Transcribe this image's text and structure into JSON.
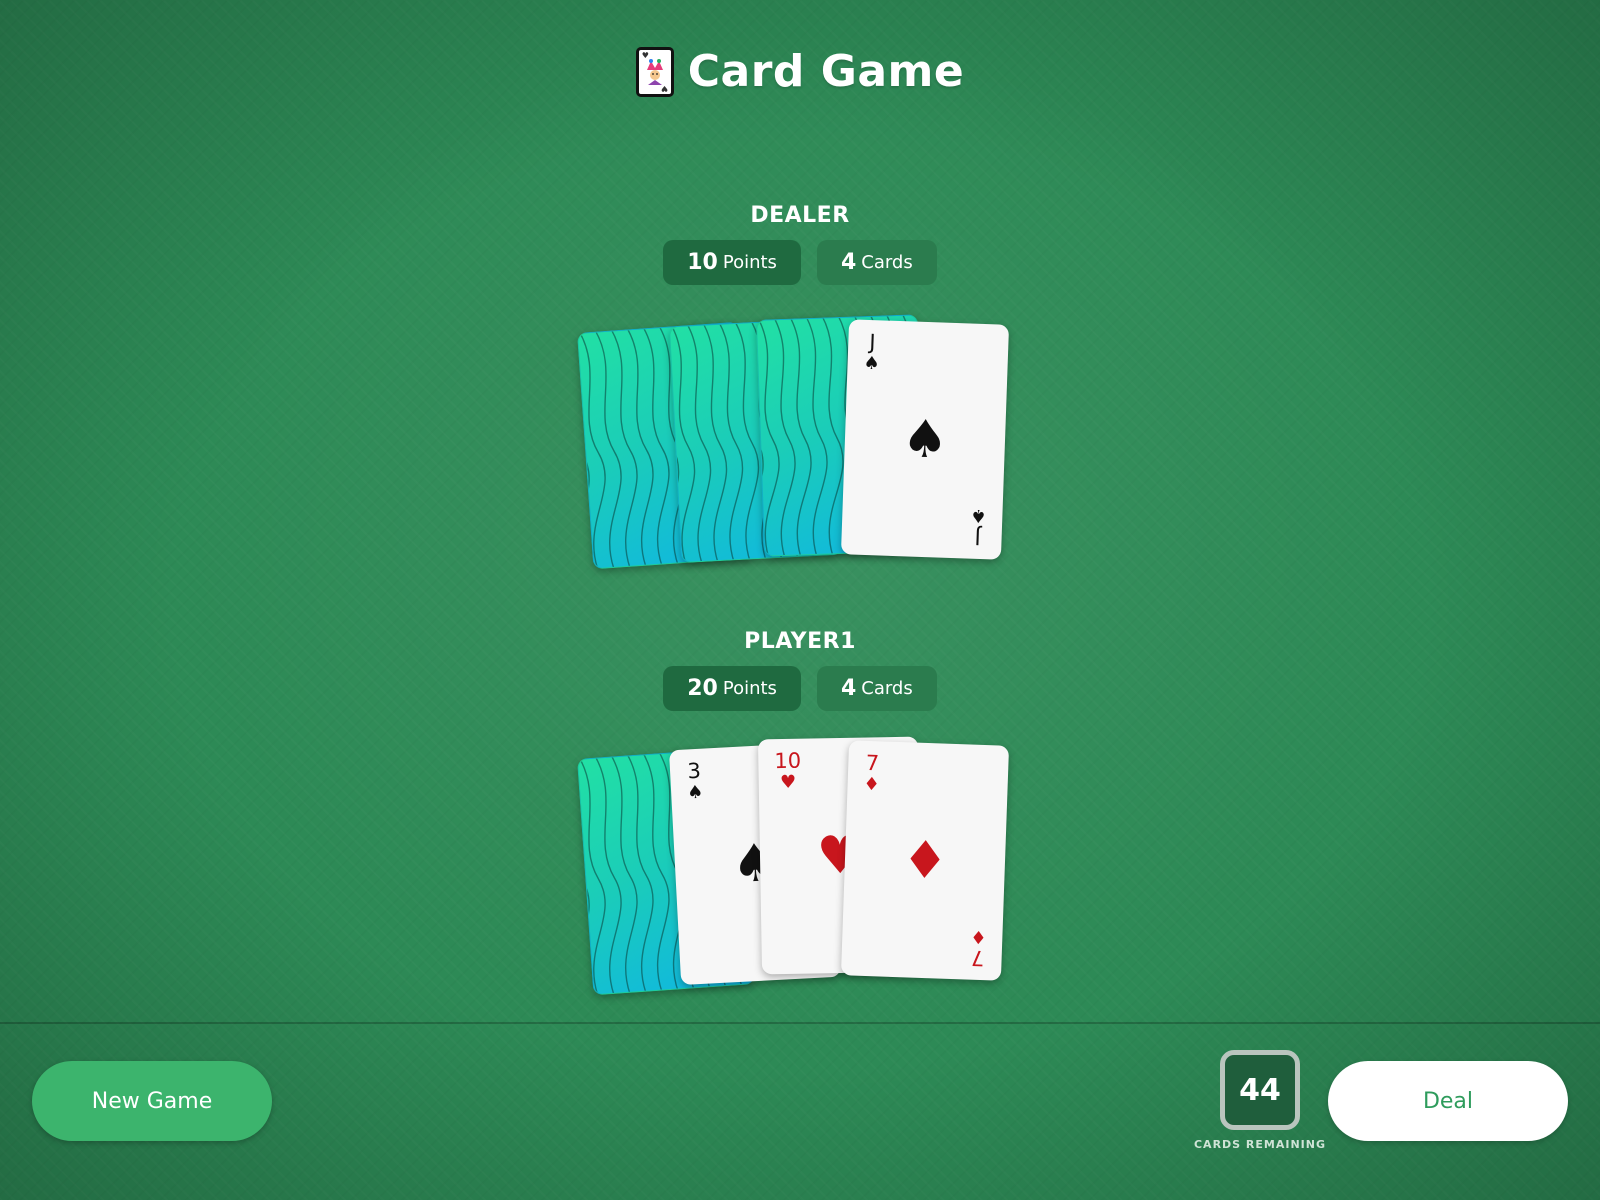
{
  "header": {
    "title": "Card Game",
    "logo_icon": "joker-card-icon"
  },
  "colors": {
    "table_felt": "#2d8a56",
    "points_badge": "#1f6a40",
    "cards_badge": "#2b7c4e",
    "primary_button": "#3cb46d",
    "card_back_top": "#22e0a4",
    "card_back_bottom": "#0fb5e3",
    "red_suit": "#c8161d"
  },
  "dealer": {
    "label": "DEALER",
    "points_value": "10",
    "points_unit": "Points",
    "cards_value": "4",
    "cards_unit": "Cards",
    "hand": [
      {
        "face_up": false
      },
      {
        "face_up": false
      },
      {
        "face_up": false
      },
      {
        "face_up": true,
        "rank": "J",
        "suit": "♠",
        "color": "black"
      }
    ]
  },
  "player": {
    "label": "PLAYER1",
    "points_value": "20",
    "points_unit": "Points",
    "cards_value": "4",
    "cards_unit": "Cards",
    "hand": [
      {
        "face_up": false
      },
      {
        "face_up": true,
        "rank": "3",
        "suit": "♠",
        "color": "black"
      },
      {
        "face_up": true,
        "rank": "10",
        "suit": "♥",
        "color": "red"
      },
      {
        "face_up": true,
        "rank": "7",
        "suit": "♦",
        "color": "red"
      }
    ]
  },
  "footer": {
    "new_game_label": "New Game",
    "deal_label": "Deal",
    "cards_remaining": "44",
    "cards_remaining_label": "CARDS REMAINING"
  }
}
